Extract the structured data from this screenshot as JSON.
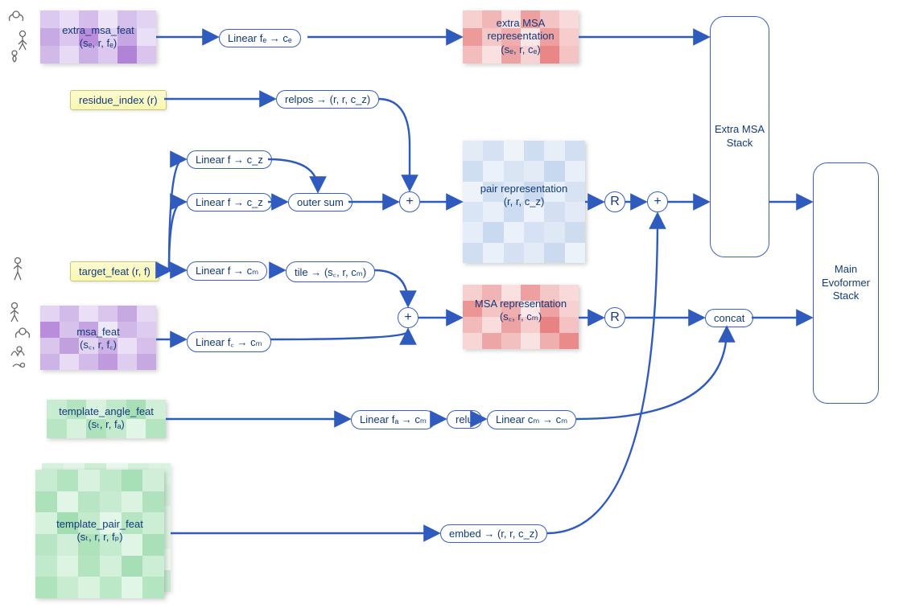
{
  "inputs": {
    "extra_msa_feat": {
      "title": "extra_msa_feat",
      "dims": "(sₑ, r, fₑ)"
    },
    "residue_index": {
      "label": "residue_index (r)"
    },
    "target_feat": {
      "label": "target_feat (r, f)"
    },
    "msa_feat": {
      "title": "msa_feat",
      "dims": "(s꜀, r, f꜀)"
    },
    "template_angle_feat": {
      "title": "template_angle_feat",
      "dims": "(sₜ, r, fₐ)"
    },
    "template_pair_feat": {
      "title": "template_pair_feat",
      "dims": "(sₜ, r, r, fₚ)"
    }
  },
  "ops": {
    "linear_fe_ce": "Linear fₑ → cₑ",
    "relpos": "relpos → (r, r, c_z)",
    "linear_f_cz_1": "Linear f → c_z",
    "linear_f_cz_2": "Linear f → c_z",
    "outer_sum": "outer sum",
    "linear_f_cm": "Linear f → cₘ",
    "tile": "tile → (s꜀, r, cₘ)",
    "linear_fc_cm": "Linear f꜀ → cₘ",
    "linear_fa_cm": "Linear fₐ → cₘ",
    "relu": "relu",
    "linear_cm_cm": "Linear cₘ → cₘ",
    "embed_pair": "embed → (r, r, c_z)",
    "concat": "concat",
    "plus": "+",
    "recycle": "R"
  },
  "reps": {
    "extra_msa": {
      "title": "extra MSA representation",
      "dims": "(sₑ, r, cₑ)"
    },
    "pair": {
      "title": "pair representation",
      "dims": "(r, r, c_z)"
    },
    "msa": {
      "title": "MSA representation",
      "dims": "(s꜀, r, cₘ)"
    }
  },
  "stacks": {
    "extra": "Extra MSA Stack",
    "main": "Main Evoformer Stack"
  }
}
